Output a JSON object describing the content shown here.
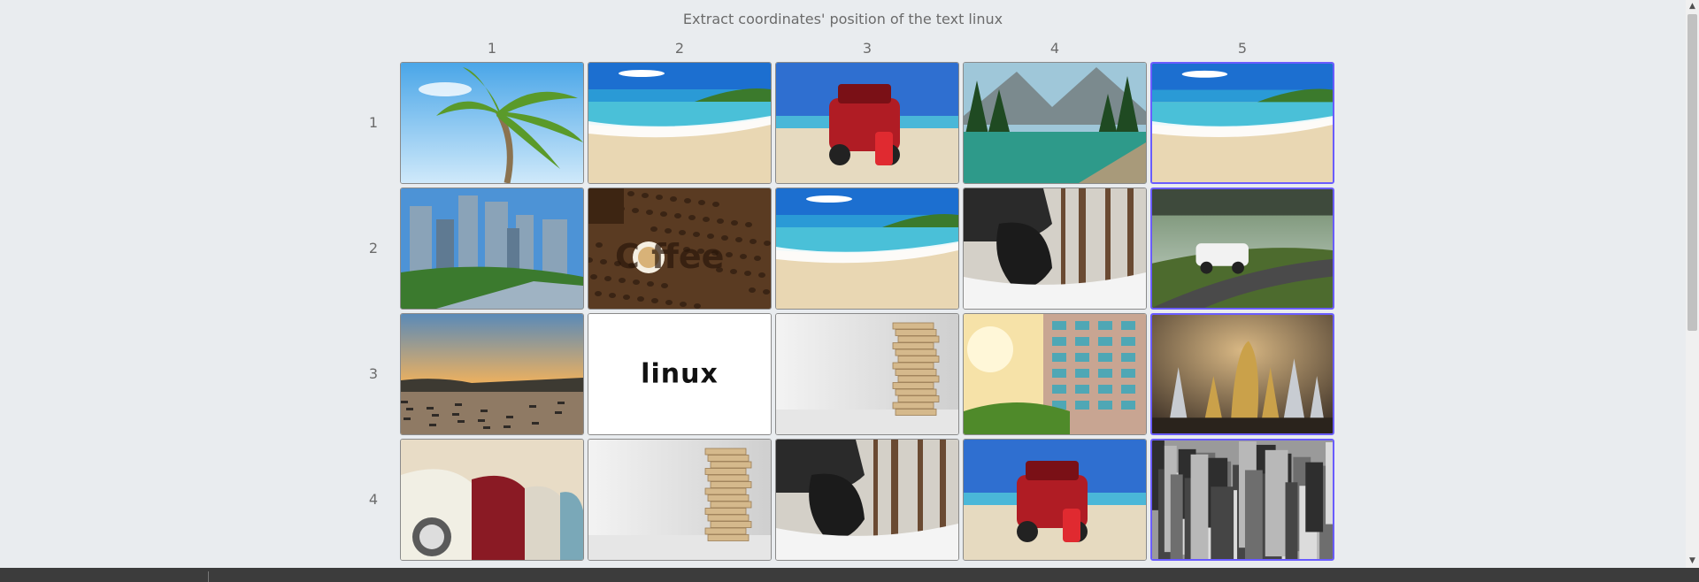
{
  "instruction": "Extract coordinates' position of the text linux",
  "columns": [
    "1",
    "2",
    "3",
    "4",
    "5"
  ],
  "rows": [
    "1",
    "2",
    "3",
    "4"
  ],
  "accent_color": "#6a5cff",
  "tiles": [
    {
      "row": 1,
      "col": 1,
      "scene": "palm-tree",
      "text": ""
    },
    {
      "row": 1,
      "col": 2,
      "scene": "beach",
      "text": ""
    },
    {
      "row": 1,
      "col": 3,
      "scene": "red-car-beach",
      "text": ""
    },
    {
      "row": 1,
      "col": 4,
      "scene": "mountain-lake",
      "text": ""
    },
    {
      "row": 1,
      "col": 5,
      "scene": "beach",
      "text": ""
    },
    {
      "row": 2,
      "col": 1,
      "scene": "skyscrapers",
      "text": ""
    },
    {
      "row": 2,
      "col": 2,
      "scene": "coffee-beans",
      "text": ""
    },
    {
      "row": 2,
      "col": 3,
      "scene": "beach",
      "text": ""
    },
    {
      "row": 2,
      "col": 4,
      "scene": "snow-tire",
      "text": ""
    },
    {
      "row": 2,
      "col": 5,
      "scene": "white-suv-road",
      "text": ""
    },
    {
      "row": 3,
      "col": 1,
      "scene": "harbor-sunset",
      "text": ""
    },
    {
      "row": 3,
      "col": 2,
      "scene": "text-card",
      "text": "linux"
    },
    {
      "row": 3,
      "col": 3,
      "scene": "wood-tower",
      "text": ""
    },
    {
      "row": 3,
      "col": 4,
      "scene": "apartment-sunset",
      "text": ""
    },
    {
      "row": 3,
      "col": 5,
      "scene": "chess",
      "text": ""
    },
    {
      "row": 4,
      "col": 1,
      "scene": "vintage-cars",
      "text": ""
    },
    {
      "row": 4,
      "col": 2,
      "scene": "wood-tower",
      "text": ""
    },
    {
      "row": 4,
      "col": 3,
      "scene": "snow-tire",
      "text": ""
    },
    {
      "row": 4,
      "col": 4,
      "scene": "red-car-beach",
      "text": ""
    },
    {
      "row": 4,
      "col": 5,
      "scene": "city-bw",
      "text": ""
    }
  ]
}
